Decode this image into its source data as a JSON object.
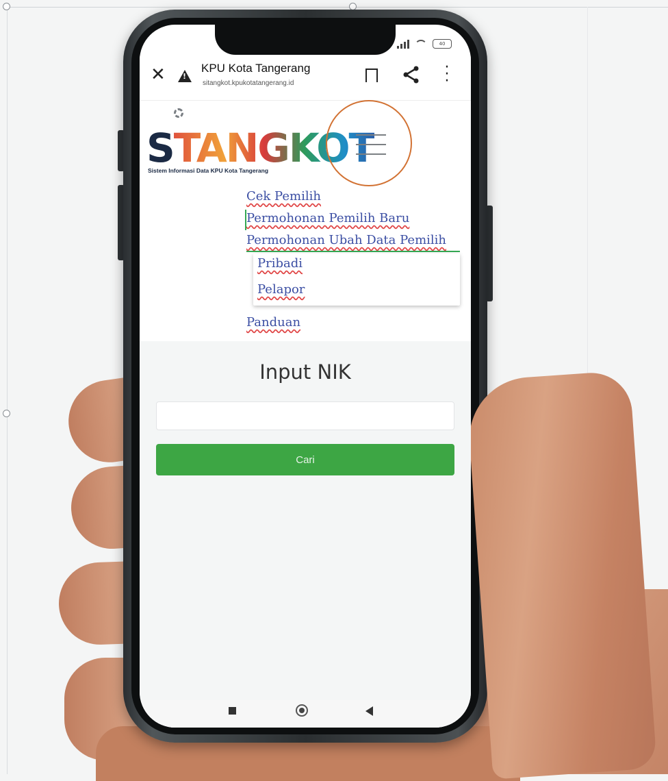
{
  "browser": {
    "site_title": "KPU Kota Tangerang",
    "site_url": "sitangkot.kpukotatangerang.id"
  },
  "status_bar": {
    "battery": "40"
  },
  "logo": {
    "text_s": "S",
    "text_mid": "TANGKOT",
    "tagline": "Sistem Informasi Data KPU Kota Tangerang"
  },
  "nav": {
    "items": [
      "Cek Pemilih",
      "Permohonan Pemilih Baru",
      "Permohonan Ubah Data Pemilih",
      "Panduan"
    ],
    "submenu": [
      "Pribadi",
      "Pelapor"
    ]
  },
  "main": {
    "title": "Input NIK",
    "search_button": "Cari",
    "input_value": ""
  },
  "colors": {
    "accent_green": "#3da644",
    "link_blue": "#3b4ea3",
    "highlight_orange": "#d27233"
  }
}
